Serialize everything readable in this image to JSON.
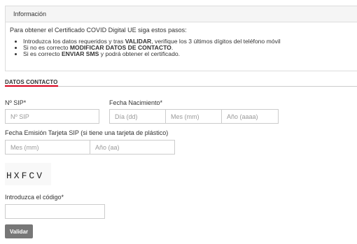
{
  "info": {
    "title": "Información",
    "intro": "Para obtener el Certificado COVID Digital UE siga estos pasos:",
    "steps": [
      {
        "pre": "Introduzca los datos requeridos y tras ",
        "bold": "VALIDAR",
        "post": ", verifique los 3 últimos dígitos del teléfono móvil"
      },
      {
        "pre": "Si no es correcto ",
        "bold": "MODIFICAR DATOS DE CONTACTO",
        "post": "."
      },
      {
        "pre": "Si es correcto ",
        "bold": "ENVIAR SMS",
        "post": " y podrá obtener el certificado."
      }
    ]
  },
  "section": {
    "title": "DATOS CONTACTO"
  },
  "form": {
    "sip": {
      "label": "Nº SIP*",
      "placeholder": "Nº SIP",
      "value": ""
    },
    "birth": {
      "label": "Fecha Nacimiento*",
      "day_placeholder": "Día (dd)",
      "month_placeholder": "Mes (mm)",
      "year_placeholder": "Año (aaaa)"
    },
    "card": {
      "label": "Fecha Emisión Tarjeta SIP (si tiene una tarjeta de plástico)",
      "month_placeholder": "Mes (mm)",
      "year_placeholder": "Año (aa)"
    },
    "captcha": {
      "text": "HXFCV"
    },
    "code": {
      "label": "Introduzca el código*",
      "value": ""
    },
    "submit_label": "Validar"
  },
  "colors": {
    "accent": "#d9001b",
    "button": "#777777"
  }
}
